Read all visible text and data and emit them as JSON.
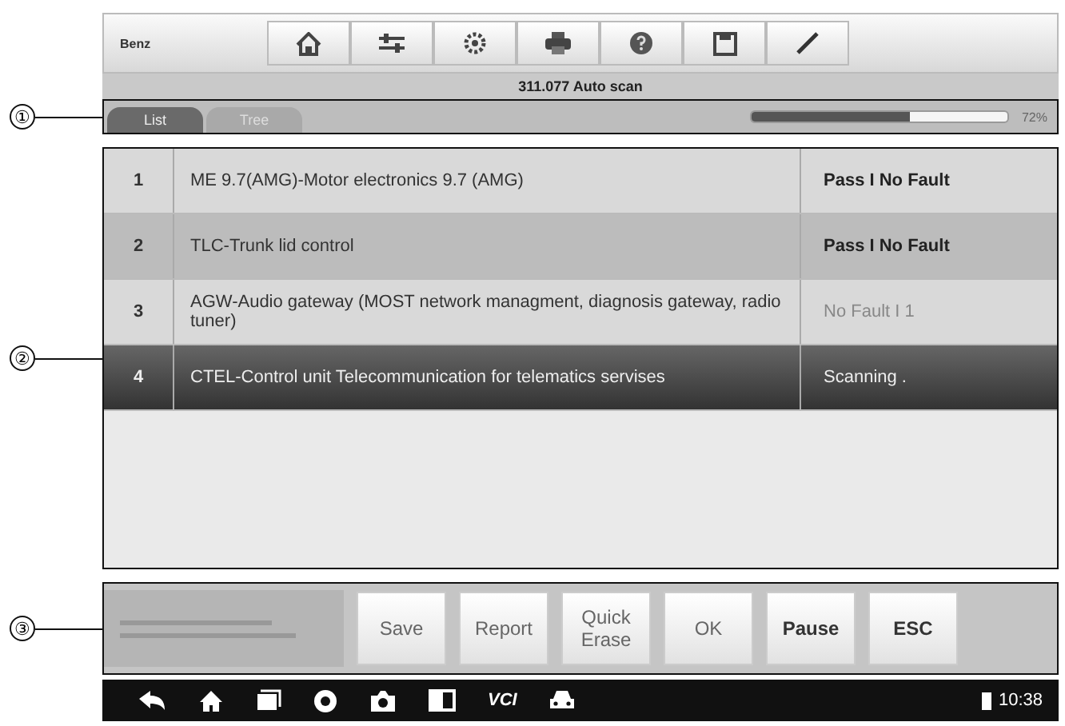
{
  "callouts": [
    "①",
    "②",
    "③"
  ],
  "toolbar": {
    "vehicle": "Benz"
  },
  "title": "311.077 Auto scan",
  "tabs": [
    {
      "label": "List",
      "selected": true
    },
    {
      "label": "Tree",
      "selected": false
    }
  ],
  "progress": {
    "level": 0.62,
    "reading": "72%"
  },
  "table": {
    "rows": [
      {
        "number": "1",
        "name": "ME 9.7(AMG)-Motor electronics 9.7 (AMG)",
        "status": "Pass I No Fault",
        "kind": "pass",
        "selected": false
      },
      {
        "number": "2",
        "name": "TLC-Trunk lid control",
        "status": "Pass I No Fault",
        "kind": "pass",
        "selected": false
      },
      {
        "number": "3",
        "name": "AGW-Audio gateway (MOST network managment, diagnosis gateway, radio tuner)",
        "status": "No Fault I 1",
        "kind": "nofault",
        "selected": false
      },
      {
        "number": "4",
        "name": "CTEL-Control unit Telecommunication for telematics servises",
        "status": "Scanning .",
        "kind": "scanning",
        "selected": true
      }
    ]
  },
  "buttons": [
    {
      "label": "Save",
      "bold": false
    },
    {
      "label": "Report",
      "bold": false
    },
    {
      "label": "Quick Erase",
      "bold": false
    },
    {
      "label": "OK",
      "bold": false
    },
    {
      "label": "Pause",
      "bold": true
    },
    {
      "label": "ESC",
      "bold": true
    }
  ],
  "navbar": {
    "vci": "VCI",
    "time": "10:38"
  }
}
